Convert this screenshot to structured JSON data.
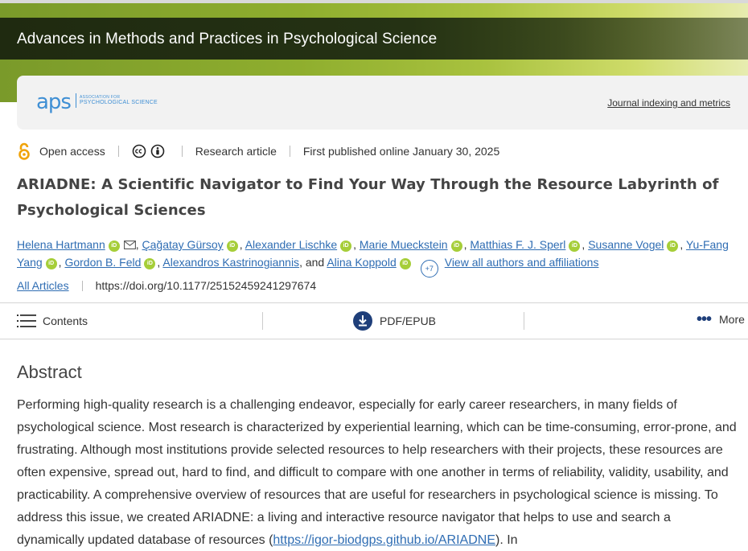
{
  "header": {
    "journal_title": "Advances in Methods and Practices in Psychological Science",
    "logo_text": "aps",
    "logo_line1": "ASSOCIATION FOR",
    "logo_line2": "PSYCHOLOGICAL SCIENCE",
    "indexing_link": "Journal indexing and metrics"
  },
  "meta": {
    "access": "Open access",
    "article_type": "Research article",
    "published": "First published online January 30, 2025"
  },
  "article": {
    "title": "ARIADNE: A Scientific Navigator to Find Your Way Through the Resource Labyrinth of Psychological Sciences",
    "authors": [
      "Helena Hartmann",
      "Çağatay Gürsoy",
      "Alexander Lischke",
      "Marie Mueckstein",
      "Matthias F. J. Sperl",
      "Susanne Vogel",
      "Yu-Fang Yang",
      "Gordon B. Feld",
      "Alexandros Kastrinogiannis",
      "Alina Koppold"
    ],
    "and_text": ", and",
    "more_count": "+7",
    "view_all": "View all authors and affiliations",
    "all_articles": "All Articles",
    "doi": "https://doi.org/10.1177/25152459241297674"
  },
  "toolbar": {
    "contents": "Contents",
    "pdf": "PDF/EPUB",
    "more": "More"
  },
  "abstract": {
    "heading": "Abstract",
    "text_before": "Performing high-quality research is a challenging endeavor, especially for early career researchers, in many fields of psychological science. Most research is characterized by experiential learning, which can be time-consuming, error-prone, and frustrating. Although most institutions provide selected resources to help researchers with their projects, these resources are often expensive, spread out, hard to find, and difficult to compare with one another in terms of reliability, validity, usability, and practicability. A comprehensive overview of resources that are useful for researchers in psychological science is missing. To address this issue, we created ARIADNE: a living and interactive resource navigator that helps to use and search a dynamically updated database of resources (",
    "link": "https://igor-biodgps.github.io/ARIADNE",
    "text_after": "). In"
  },
  "colors": {
    "link": "#2f6db3",
    "orcid": "#a6ce39",
    "header_band": "#253214",
    "open_access": "#f0a30a"
  }
}
